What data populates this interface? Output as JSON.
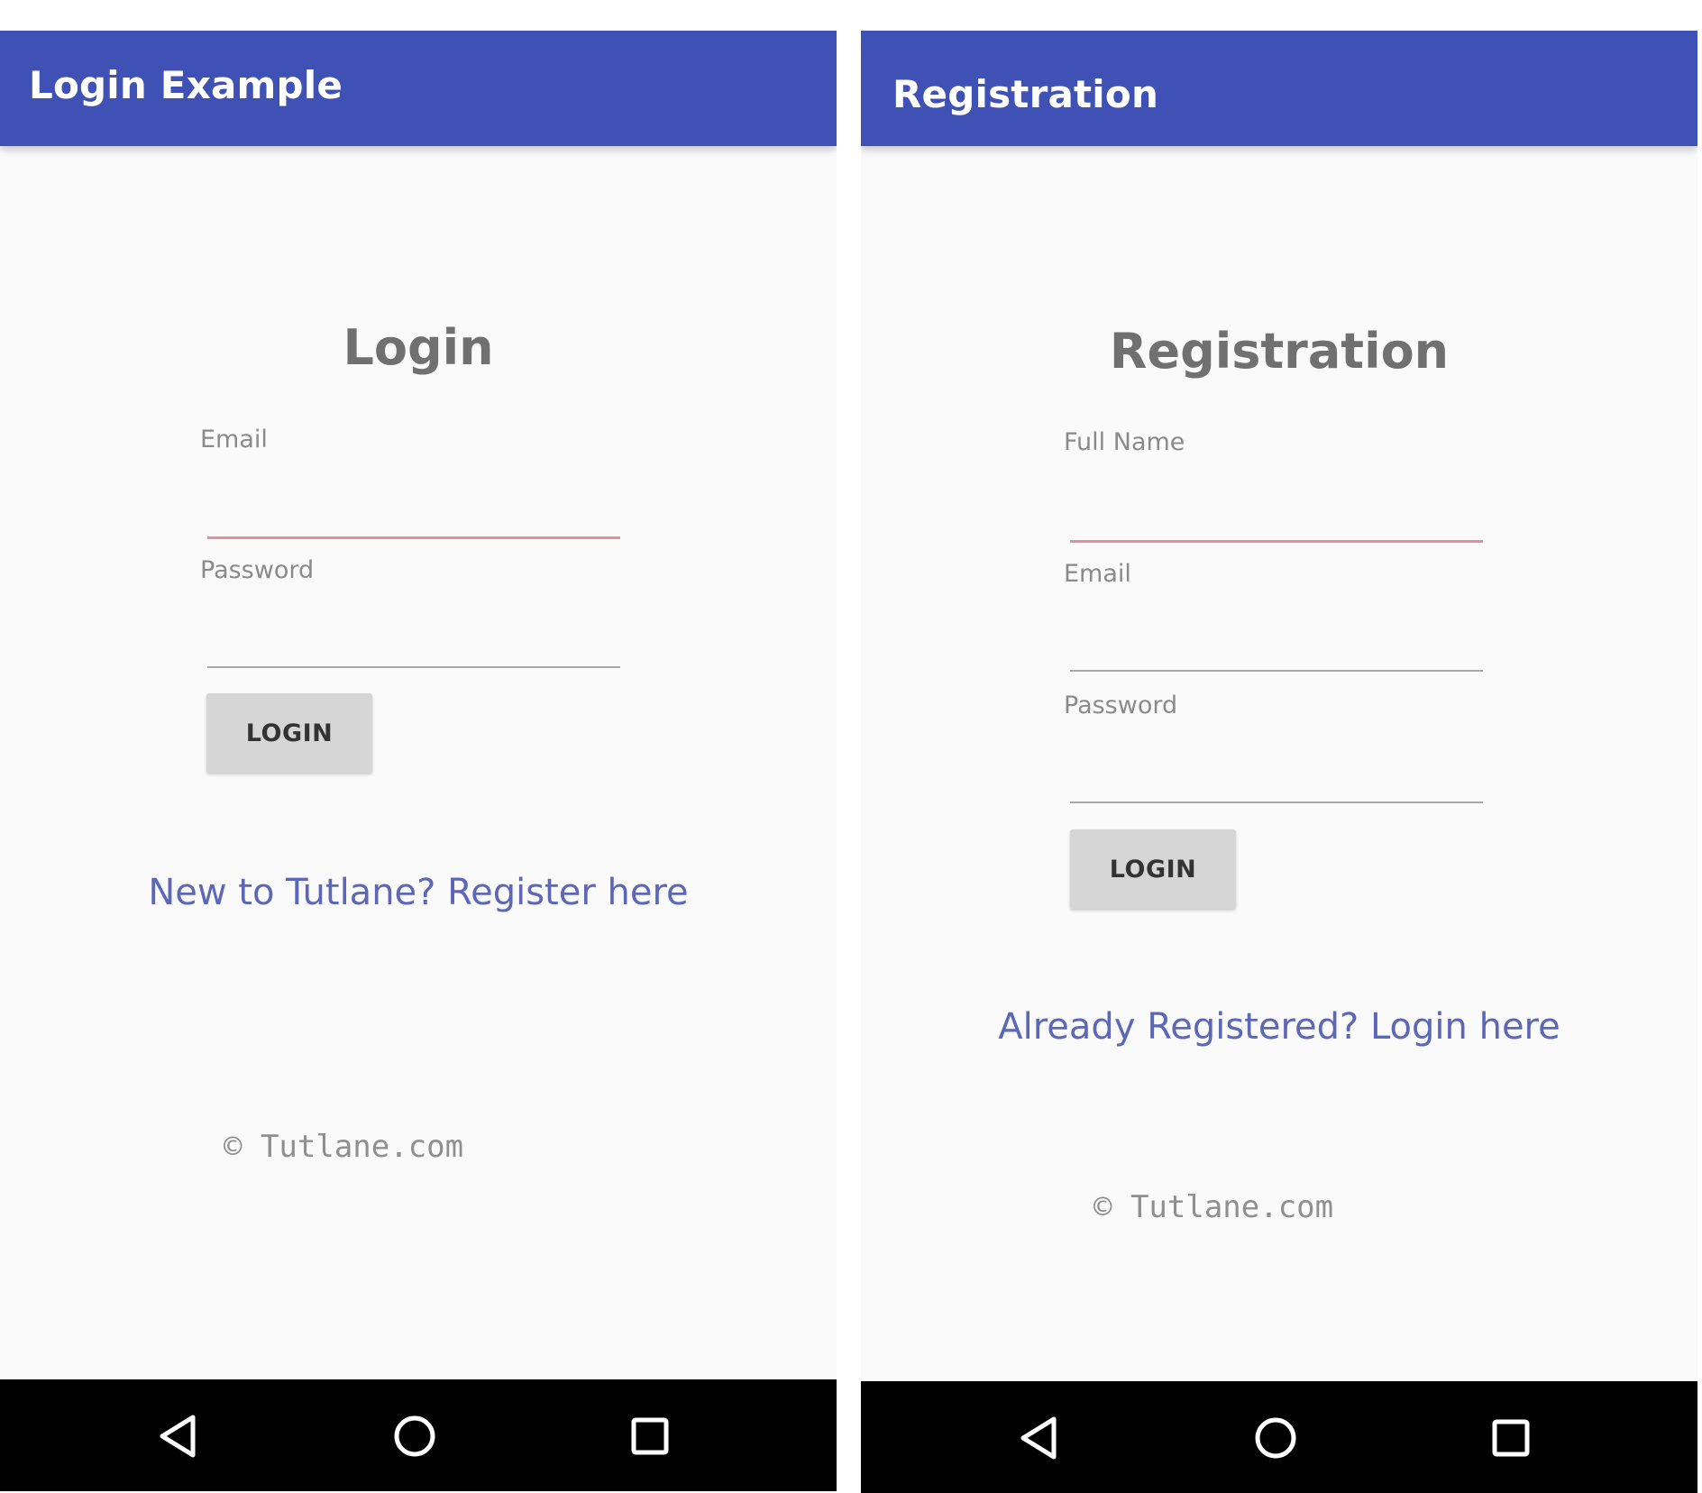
{
  "login_screen": {
    "appbar_title": "Login Example",
    "heading": "Login",
    "email_label": "Email",
    "email_value": "",
    "password_label": "Password",
    "password_value": "",
    "button_label": "LOGIN",
    "register_link": "New to Tutlane? Register here",
    "copyright": "© Tutlane.com"
  },
  "registration_screen": {
    "appbar_title": "Registration",
    "heading": "Registration",
    "fullname_label": "Full Name",
    "fullname_value": "",
    "email_label": "Email",
    "email_value": "",
    "password_label": "Password",
    "password_value": "",
    "button_label": "LOGIN",
    "login_link": "Already Registered? Login here",
    "copyright": "© Tutlane.com"
  },
  "navbar": {
    "icons": [
      "back-icon",
      "home-icon",
      "recents-icon"
    ]
  },
  "colors": {
    "appbar": "#3f51b5",
    "link": "#5c67b8",
    "focus_underline": "#e58ca4",
    "button": "#d6d6d6",
    "navbar": "#000000"
  }
}
